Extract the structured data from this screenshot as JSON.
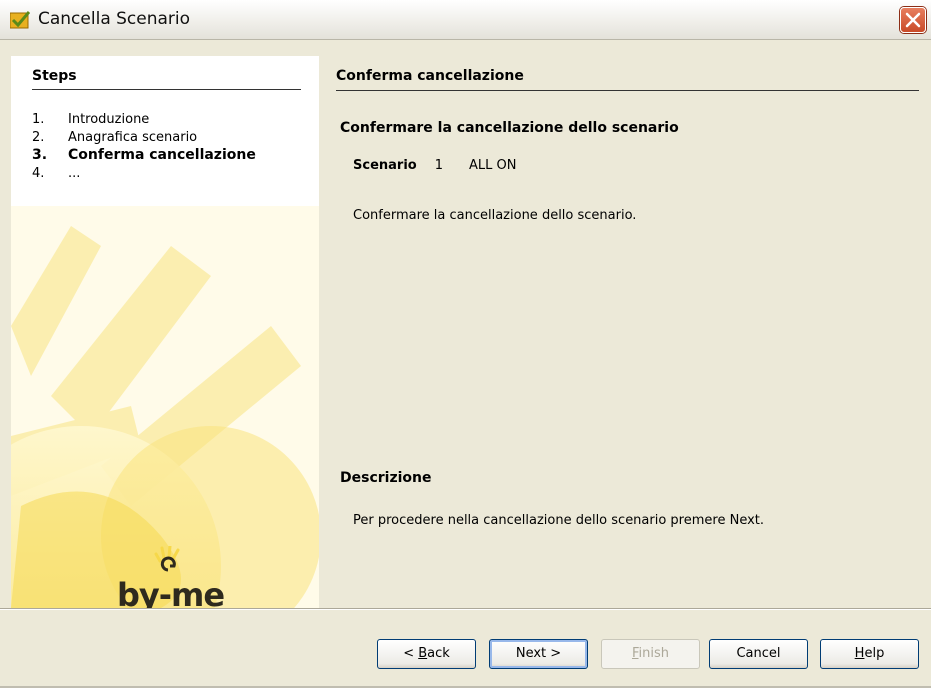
{
  "window": {
    "title": "Cancella Scenario"
  },
  "steps": {
    "heading": "Steps",
    "items": [
      {
        "num": "1.",
        "label": "Introduzione"
      },
      {
        "num": "2.",
        "label": "Anagrafica scenario"
      },
      {
        "num": "3.",
        "label": "Conferma cancellazione"
      },
      {
        "num": "4.",
        "label": "..."
      }
    ],
    "current_index": 2,
    "logo_text": "by-me"
  },
  "content": {
    "heading": "Conferma cancellazione",
    "confirm_title": "Confermare la cancellazione dello scenario",
    "scenario_label": "Scenario",
    "scenario_number": "1",
    "scenario_name": "ALL ON",
    "confirm_message": "Confermare la cancellazione dello scenario.",
    "description_heading": "Descrizione",
    "description_text": "Per procedere nella cancellazione dello scenario premere Next."
  },
  "buttons": {
    "back": {
      "mnemonic": "B",
      "rest": "ack",
      "prefix": "< "
    },
    "next": "Next >",
    "finish": {
      "mnemonic": "F",
      "rest": "inish"
    },
    "cancel": "Cancel",
    "help": {
      "mnemonic": "H",
      "rest": "elp"
    }
  },
  "colors": {
    "accent_yellow": "#f6d84a",
    "close_red": "#d9593a"
  }
}
